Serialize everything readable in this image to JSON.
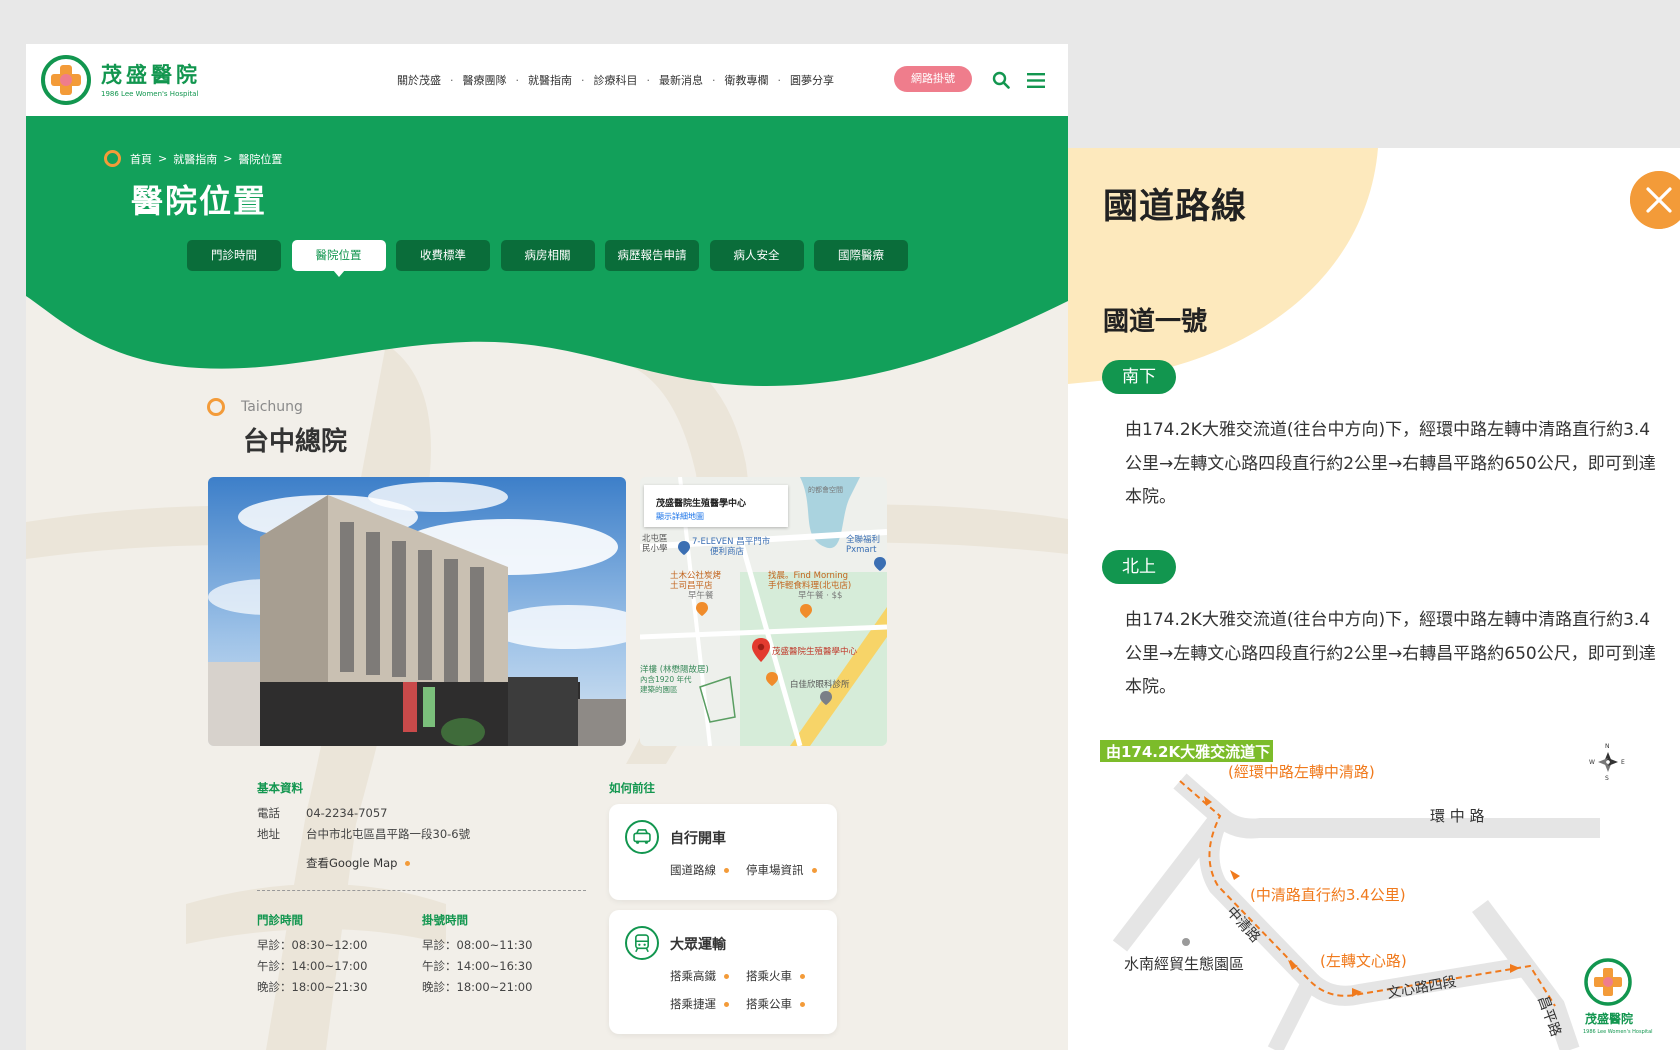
{
  "header": {
    "logo_cn": "茂盛醫院",
    "logo_en": "1986 Lee Women's Hospital",
    "nav": [
      "關於茂盛",
      "醫療團隊",
      "就醫指南",
      "診療科目",
      "最新消息",
      "衛教專欄",
      "圓夢分享"
    ],
    "nav_separator": "·",
    "register_button": "網路掛號"
  },
  "breadcrumb": [
    "首頁",
    "就醫指南",
    "醫院位置"
  ],
  "breadcrumb_separator": ">",
  "page_title": "醫院位置",
  "tabs": [
    {
      "label": "門診時間",
      "active": false
    },
    {
      "label": "醫院位置",
      "active": true
    },
    {
      "label": "收費標準",
      "active": false
    },
    {
      "label": "病房相關",
      "active": false
    },
    {
      "label": "病歷報告申請",
      "active": false
    },
    {
      "label": "病人安全",
      "active": false
    },
    {
      "label": "國際醫療",
      "active": false
    }
  ],
  "location": {
    "name_en": "Taichung",
    "name": "台中總院"
  },
  "map": {
    "place_title": "茂盛醫院生殖醫學中心",
    "detail_link": "顯示詳細地圖",
    "labels": {
      "seven_eleven": "7-ELEVEN 昌平門市",
      "seven_eleven_sub": "便利商店",
      "pxmart": "全聯福利",
      "pxmart_2": "Pxmart",
      "find_morning": "找晨。Find Morning",
      "find_morning_2": "手作輕食料理(北屯店)",
      "find_morning_3": "早午餐 · $$",
      "tumu": "土木公社炭烤",
      "tumu_2": "土司昌平店",
      "tumu_3": "早午餐",
      "pin_label": "茂盛醫院生殖醫學中心",
      "eye_clinic": "白佳欣眼科診所",
      "yang": "洋樓 (林懋陽故居)",
      "yang_2": "內含1920 年代",
      "yang_3": "建築的園區",
      "school": "北屯區",
      "school_2": "民小學",
      "top_right": "的都會空間"
    }
  },
  "basic_info": {
    "heading": "基本資料",
    "phone_label": "電話",
    "phone": "04-2234-7057",
    "address_label": "地址",
    "address": "台中市北屯區昌平路一段30-6號",
    "gmap_link": "查看Google Map"
  },
  "clinic_hours": {
    "heading": "門診時間",
    "rows": [
      "早診：08:30~12:00",
      "午診：14:00~17:00",
      "晚診：18:00~21:30"
    ]
  },
  "reg_hours": {
    "heading": "掛號時間",
    "rows": [
      "早診：08:00~11:30",
      "午診：14:00~16:30",
      "晚診：18:00~21:00"
    ]
  },
  "how_to": {
    "heading": "如何前往",
    "drive": {
      "title": "自行開車",
      "links": [
        "國道路線",
        "停車場資訊"
      ]
    },
    "transit": {
      "title": "大眾運輸",
      "links": [
        "搭乘高鐵",
        "搭乘火車",
        "搭乘捷運",
        "搭乘公車"
      ]
    }
  },
  "panel": {
    "title": "國道路線",
    "route_title": "國道一號",
    "south_label": "南下",
    "south_text": "由174.2K大雅交流道(往台中方向)下，經環中路左轉中清路直行約3.4公里→左轉文心路四段直行約2公里→右轉昌平路約650公尺，即可到達本院。",
    "north_label": "北上",
    "north_text": "由174.2K大雅交流道(往台中方向)下，經環中路左轉中清路直行約3.4公里→左轉文心路四段直行約2公里→右轉昌平路約650公尺，即可到達本院。",
    "route_map": {
      "exit_label": "由174.2K大雅交流道下",
      "note1": "(經環中路左轉中清路)",
      "road_huanzhong": "環 中 路",
      "note2": "(中清路直行約3.4公里)",
      "road_zhongqing": "中清路",
      "note3": "(左轉文心路)",
      "road_wenxin": "文心路四段",
      "road_changping": "昌平路",
      "landmark": "水南經貿生態園區",
      "logo_cn": "茂盛醫院",
      "logo_en": "1986 Lee Women's Hospital",
      "compass_n": "N",
      "compass_s": "S",
      "compass_w": "W",
      "compass_e": "E"
    }
  },
  "colors": {
    "brand_green": "#12964f",
    "dark_green": "#0a6d3a",
    "accent_orange": "#f39b39",
    "pink": "#ef7d8c",
    "cream": "#fde9bd",
    "beige": "#f2efe9"
  }
}
